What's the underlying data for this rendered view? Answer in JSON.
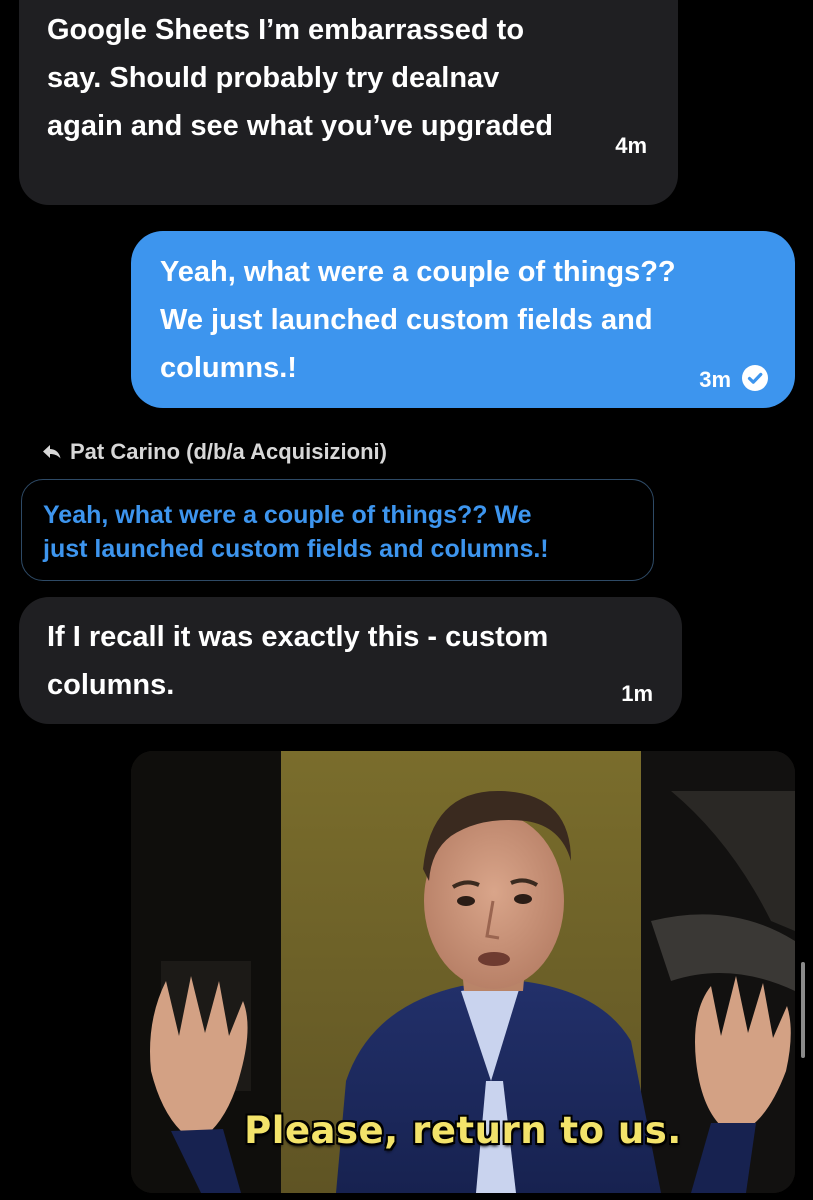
{
  "messages": [
    {
      "direction": "incoming",
      "text": "Google Sheets I’m embarrassed to\nsay. Should probably try dealnav\nagain and see what you’ve upgraded",
      "time": "4m"
    },
    {
      "direction": "outgoing",
      "text": "Yeah, what were a couple of things??\nWe just launched custom fields and\ncolumns.!",
      "time": "3m",
      "status_icon": "check-circle-icon"
    },
    {
      "direction": "incoming",
      "reply_to": {
        "author": "Pat Carino (d/b/a Acquisizioni)",
        "icon": "reply-arrow-icon",
        "quoted_text": "Yeah, what were a couple of things?? We\njust launched custom fields and columns.!"
      },
      "text": "If I recall it was exactly this - custom\ncolumns.",
      "time": "1m"
    },
    {
      "direction": "outgoing",
      "media_type": "gif",
      "caption": "Please, return to us."
    }
  ],
  "colors": {
    "background": "#000000",
    "incoming_bubble": "#1f1f22",
    "outgoing_bubble": "#3d95ee",
    "quoted_text": "#3d95ee",
    "caption": "#f3e36a"
  }
}
